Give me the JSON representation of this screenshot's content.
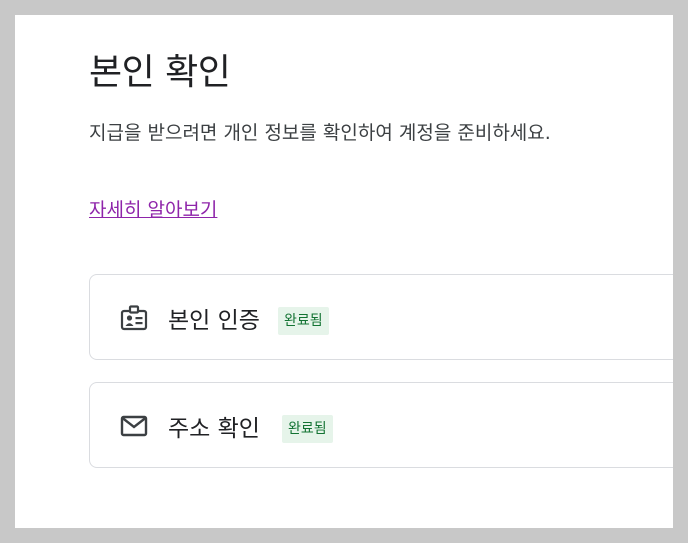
{
  "page": {
    "title": "본인 확인",
    "description": "지급을 받으려면 개인 정보를 확인하여 계정을 준비하세요.",
    "learn_more": "자세히 알아보기"
  },
  "cards": [
    {
      "label": "본인 인증",
      "status": "완료됨",
      "icon": "id-badge-icon"
    },
    {
      "label": "주소 확인",
      "status": "완료됨",
      "icon": "mail-icon"
    }
  ],
  "colors": {
    "badge_bg": "#e6f4ea",
    "badge_text": "#137333",
    "link": "#8e24aa"
  }
}
